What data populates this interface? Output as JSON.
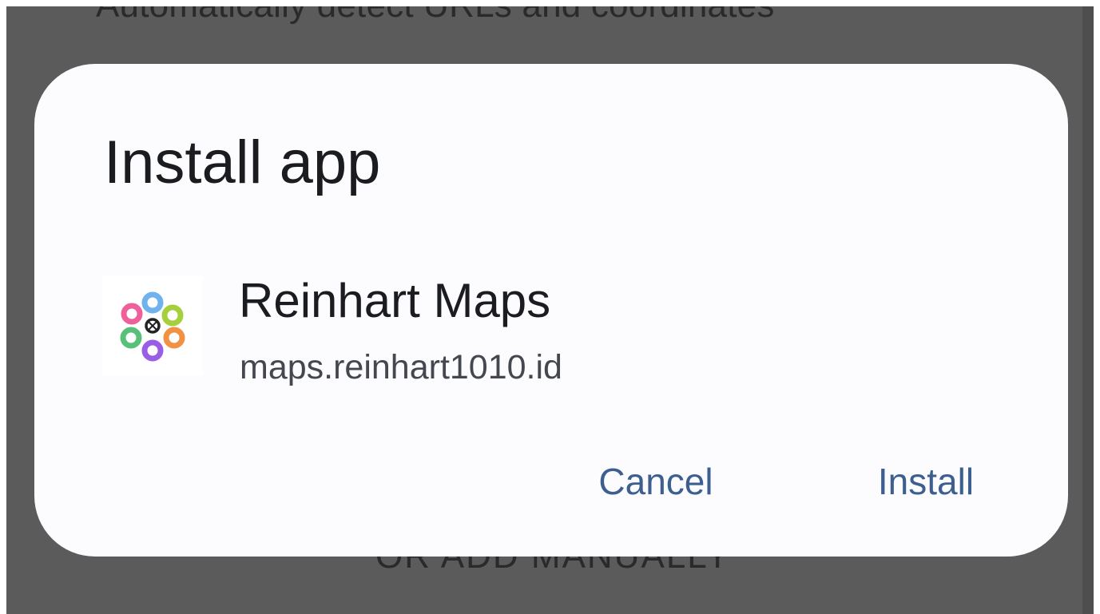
{
  "background": {
    "top_text": "Automatically detect URLs and coordinates",
    "bottom_text": "OR ADD MANUALLY"
  },
  "dialog": {
    "title": "Install app",
    "app": {
      "name": "Reinhart Maps",
      "url": "maps.reinhart1010.id",
      "icon": "reinhart-maps-flower-logo"
    },
    "buttons": {
      "cancel": "Cancel",
      "install": "Install"
    }
  },
  "colors": {
    "scrim": "#5b5b5b",
    "dialog_surface": "#fcfcff",
    "title_text": "#1b1c20",
    "secondary_text": "#44474e",
    "button_text": "#3d5f8f"
  }
}
